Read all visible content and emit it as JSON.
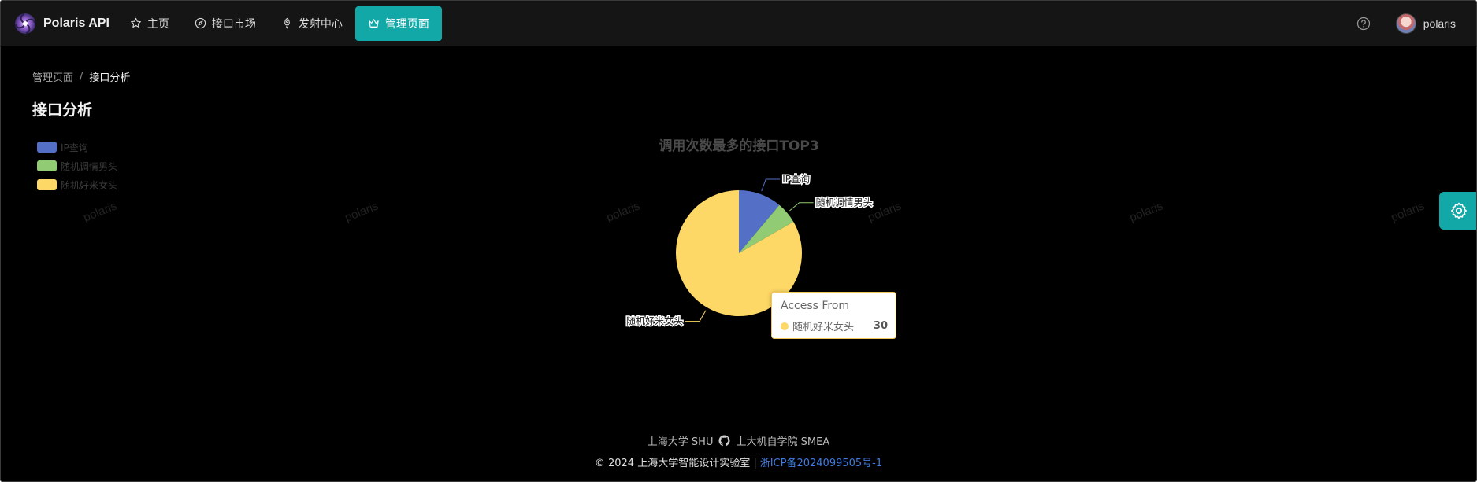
{
  "brand": {
    "name": "Polaris API"
  },
  "nav": {
    "items": [
      {
        "label": "主页",
        "icon": "star-icon"
      },
      {
        "label": "接口市场",
        "icon": "compass-icon"
      },
      {
        "label": "发射中心",
        "icon": "rocket-icon"
      },
      {
        "label": "管理页面",
        "icon": "crown-icon",
        "active": true
      }
    ],
    "help_icon": "question-circle-icon",
    "username": "polaris"
  },
  "breadcrumb": {
    "parent": "管理页面",
    "separator": "/",
    "current": "接口分析"
  },
  "page_title": "接口分析",
  "watermark_text": "polaris",
  "chart_data": {
    "type": "pie",
    "title": "调用次数最多的接口TOP3",
    "legend_position": "top-left",
    "slices": [
      {
        "name": "IP查询",
        "value": 4,
        "color": "#5470c6"
      },
      {
        "name": "随机调情男头",
        "value": 2,
        "color": "#91cc75"
      },
      {
        "name": "随机好米女头",
        "value": 30,
        "color": "#fdd866"
      }
    ],
    "tooltip": {
      "title": "Access From",
      "name": "随机好米女头",
      "value": "30"
    }
  },
  "footer": {
    "line1_left": "上海大学 SHU",
    "line1_right": "上大机自学院 SMEA",
    "copyright": "© 2024 上海大学智能设计实验室 |",
    "icp": "浙ICP备2024099505号-1"
  },
  "colors": {
    "accent": "#13a8a8",
    "background": "#000000",
    "link": "#3f7be0"
  }
}
